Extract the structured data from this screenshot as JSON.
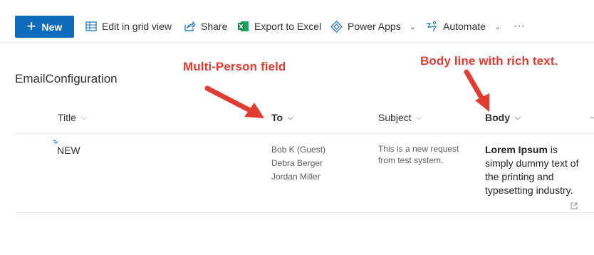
{
  "toolbar": {
    "new_label": "New",
    "edit_grid_label": "Edit in grid view",
    "share_label": "Share",
    "export_label": "Export to Excel",
    "powerapps_label": "Power Apps",
    "automate_label": "Automate",
    "more_label": "···"
  },
  "list": {
    "title": "EmailConfiguration",
    "columns": [
      {
        "label": "Title"
      },
      {
        "label": "To"
      },
      {
        "label": "Subject"
      },
      {
        "label": "Body"
      }
    ],
    "rows": [
      {
        "title": "NEW",
        "to": [
          "Bob K (Guest)",
          "Debra Berger",
          "Jordan Miller"
        ],
        "subject": "This is a new request from test system.",
        "body_bold": "Lorem Ipsum",
        "body_text": " is simply dummy text of the printing and typesetting industry. Lorem"
      }
    ]
  },
  "annotations": {
    "multi_person": "Multi-Person field",
    "body_rich": "Body line with rich text."
  },
  "colors": {
    "brand": "#0f6cbd",
    "annotation": "#e03c31",
    "excel_green": "#107c41"
  }
}
